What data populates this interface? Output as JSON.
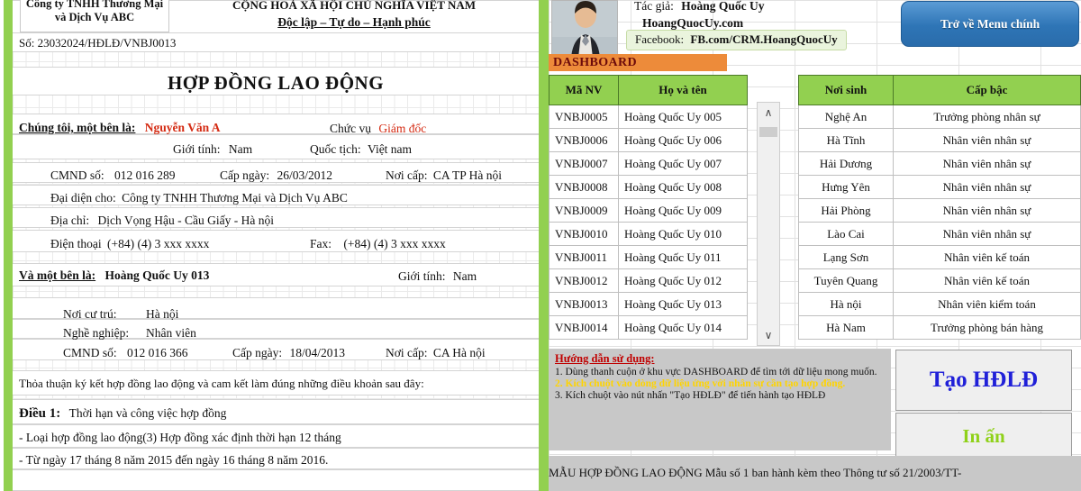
{
  "document": {
    "company_header": [
      "Công ty TNHH Thương Mại",
      "và Dịch Vụ ABC"
    ],
    "national_header": [
      "CỘNG HOÀ XÃ HỘI CHỦ NGHĨA VIỆT NAM",
      "Độc lập – Tự do – Hạnh phúc"
    ],
    "contract_number": "Số: 23032024/HĐLĐ/VNBJ0013",
    "title": "HỢP ĐỒNG LAO ĐỘNG",
    "party_a": {
      "intro_label": "Chúng tôi, một bên là:",
      "name": "Nguyễn Văn A",
      "position_label": "Chức vụ",
      "position": "Giám đốc",
      "gender_label": "Giới tính:",
      "gender": "Nam",
      "nationality_label": "Quốc tịch:",
      "nationality": "Việt nam",
      "id_label": "CMND số:",
      "id_number": "012 016 289",
      "issue_date_label": "Cấp ngày:",
      "issue_date": "26/03/2012",
      "issue_place_label": "Nơi cấp:",
      "issue_place": "CA TP Hà nội",
      "represent_label": "Đại diện cho:",
      "represent": "Công ty TNHH Thương Mại và Dịch Vụ ABC",
      "address_label": "Địa chỉ:",
      "address": "Dịch Vọng Hậu - Cầu Giấy - Hà nội",
      "phone_label": "Điện thoại",
      "phone": "(+84) (4) 3 xxx xxxx",
      "fax_label": "Fax:",
      "fax": "(+84) (4) 3 xxx xxxx"
    },
    "party_b": {
      "intro_label": "Và một bên là:",
      "name": "Hoàng Quốc Uy 013",
      "gender_label": "Giới tính:",
      "gender": "Nam",
      "residence_label": "Nơi cư trú:",
      "residence": "Hà nội",
      "occupation_label": "Nghề nghiệp:",
      "occupation": "Nhân viên",
      "id_label": "CMND số:",
      "id_number": "012 016 366",
      "issue_date_label": "Cấp ngày:",
      "issue_date": "18/04/2013",
      "issue_place_label": "Nơi cấp:",
      "issue_place": "CA Hà nội"
    },
    "agreement_line": "Thỏa thuận ký kết hợp đồng lao động và cam kết làm đúng những điều khoản sau đây:",
    "article_1_label": "Điều 1:",
    "article_1_title": "Thời hạn và công việc hợp đồng",
    "article_1_items": [
      "- Loại hợp đồng lao động(3) Hợp đồng xác định thời hạn 12 tháng",
      "- Từ ngày 17 tháng 8 năm 2015 đến ngày 16 tháng 8 năm 2016."
    ]
  },
  "author": {
    "label": "Tác giả:",
    "name": "Hoàng Quốc Uy",
    "website": "HoangQuocUy.com",
    "facebook_label": "Facebook:",
    "facebook_value": "FB.com/CRM.HoangQuocUy"
  },
  "dashboard": {
    "ribbon_label": "DASHBOARD",
    "menu_button": "Trở về Menu chính",
    "columns_left": [
      "Mã NV",
      "Họ và tên"
    ],
    "columns_right": [
      "Nơi sinh",
      "Cấp bậc"
    ],
    "rows": [
      {
        "id": "VNBJ0005",
        "name": "Hoàng Quốc Uy 005",
        "born": "Nghệ An",
        "rank": "Trưởng phòng nhân sự"
      },
      {
        "id": "VNBJ0006",
        "name": "Hoàng Quốc Uy 006",
        "born": "Hà Tĩnh",
        "rank": "Nhân viên nhân sự"
      },
      {
        "id": "VNBJ0007",
        "name": "Hoàng Quốc Uy 007",
        "born": "Hải Dương",
        "rank": "Nhân viên nhân sự"
      },
      {
        "id": "VNBJ0008",
        "name": "Hoàng Quốc Uy 008",
        "born": "Hưng Yên",
        "rank": "Nhân viên nhân sự"
      },
      {
        "id": "VNBJ0009",
        "name": "Hoàng Quốc Uy 009",
        "born": "Hải Phòng",
        "rank": "Nhân viên nhân sự"
      },
      {
        "id": "VNBJ0010",
        "name": "Hoàng Quốc Uy 010",
        "born": "Lào Cai",
        "rank": "Nhân viên nhân sự"
      },
      {
        "id": "VNBJ0011",
        "name": "Hoàng Quốc Uy 011",
        "born": "Lạng Sơn",
        "rank": "Nhân viên kế toán"
      },
      {
        "id": "VNBJ0012",
        "name": "Hoàng Quốc Uy 012",
        "born": "Tuyên Quang",
        "rank": "Nhân viên kế toán"
      },
      {
        "id": "VNBJ0013",
        "name": "Hoàng Quốc Uy 013",
        "born": "Hà nội",
        "rank": "Nhân viên kiểm toán"
      },
      {
        "id": "VNBJ0014",
        "name": "Hoàng Quốc Uy 014",
        "born": "Hà Nam",
        "rank": "Trưởng phòng bán hàng"
      }
    ],
    "scroll_up_glyph": "∧",
    "scroll_down_glyph": "∨"
  },
  "instructions": {
    "title": "Hướng dẫn sử dụng:",
    "steps": [
      "1. Dùng thanh cuộn ở khu vực DASHBOARD để tìm tới dữ liệu mong muốn.",
      "2. Kích chuột vào dòng dữ liệu ứng với nhân sự cần tạo hợp đồng.",
      "3. Kích chuột vào nút nhấn \"Tạo HĐLĐ\" để tiến hành tạo HĐLĐ"
    ],
    "highlight_index": 1
  },
  "actions": {
    "create_label": "Tạo HĐLĐ",
    "print_label": "In ấn"
  },
  "footer": {
    "note": "MẪU HỢP ĐỒNG LAO ĐỘNG Mẫu số 1 ban hành kèm theo Thông tư số 21/2003/TT-"
  },
  "colors": {
    "green_rail": "#92d050",
    "header_green": "#92d050",
    "orange_ribbon": "#ed8b3a",
    "blue_button": "#2e75b6",
    "red_text": "#d42a12",
    "create_blue": "#2020d8",
    "print_green": "#8fd119",
    "highlight_yellow": "#ffd400"
  }
}
